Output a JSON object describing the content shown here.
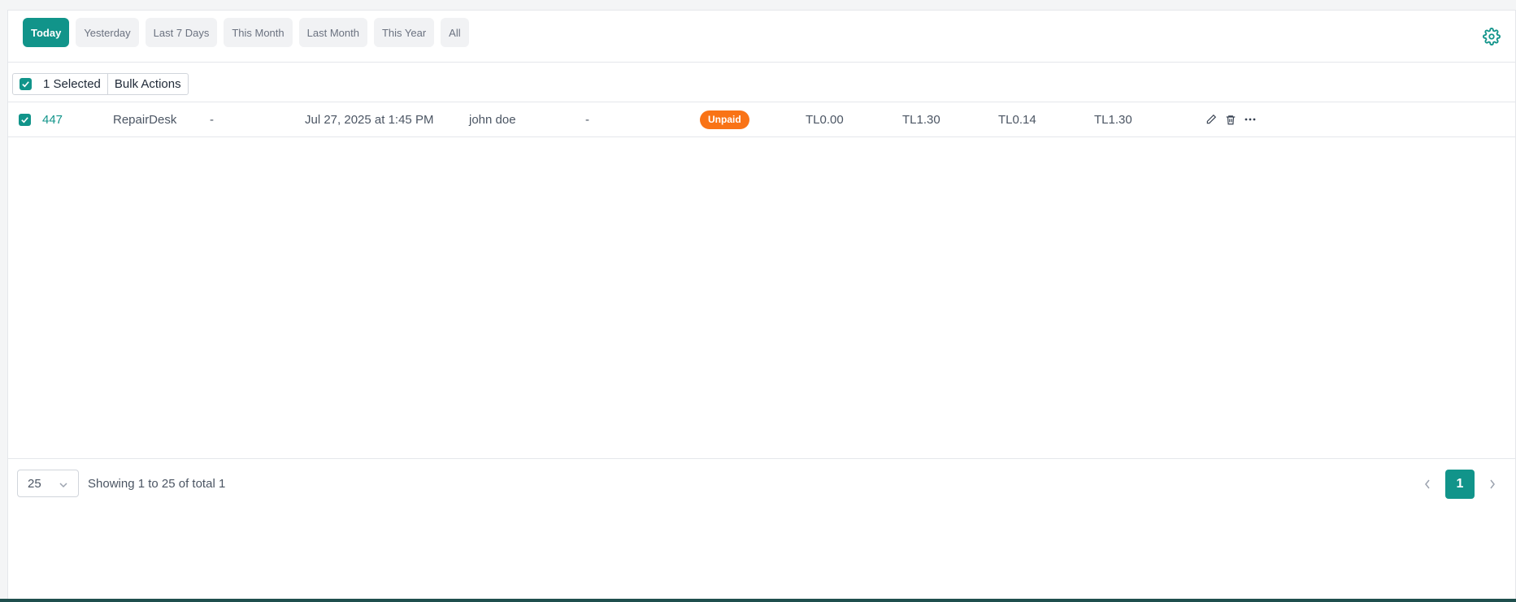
{
  "filters": {
    "today": "Today",
    "yesterday": "Yesterday",
    "last7": "Last 7 Days",
    "this_month": "This Month",
    "last_month": "Last Month",
    "this_year": "This Year",
    "all": "All",
    "active": "Today"
  },
  "selection": {
    "count_label": "1 Selected",
    "bulk_label": "Bulk Actions"
  },
  "rows": [
    {
      "id": "447",
      "store": "RepairDesk",
      "customer": "-",
      "date": "Jul 27, 2025 at 1:45 PM",
      "employee": "john doe",
      "reference": "-",
      "status": "Unpaid",
      "paid": "TL0.00",
      "total": "TL1.30",
      "tax": "TL0.14",
      "due": "TL1.30"
    }
  ],
  "footer": {
    "per_page": "25",
    "showing": "Showing 1 to 25 of total 1",
    "current_page": "1"
  },
  "icons": {
    "settings": "gear-icon",
    "edit": "pencil-icon",
    "delete": "trash-icon",
    "more": "ellipsis-icon",
    "prev": "chevron-left-icon",
    "next": "chevron-right-icon"
  },
  "colors": {
    "accent": "#11948a",
    "status_unpaid": "#f97316"
  }
}
